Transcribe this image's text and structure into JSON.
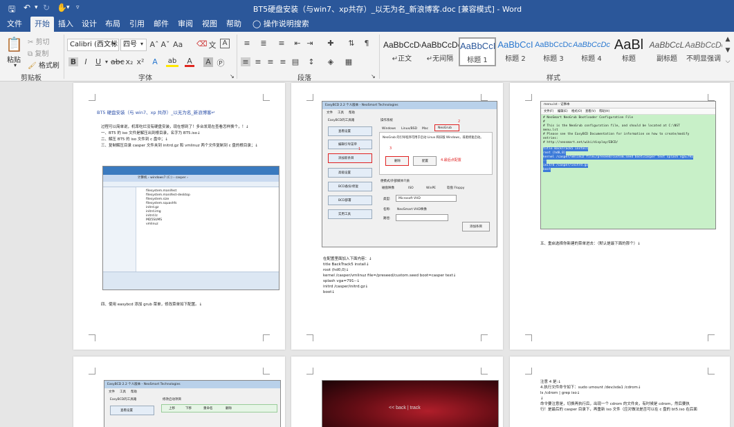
{
  "window": {
    "title": "BT5硬盘安装（与win7、xp共存）_以无为名_新浪博客.doc [兼容模式] - Word"
  },
  "quick_access": {
    "save_icon": "save-icon",
    "undo_icon": "undo-icon",
    "redo_icon": "redo-icon",
    "touch_icon": "touch-mode-icon",
    "customize_icon": "customize-icon"
  },
  "tabs": [
    "文件",
    "开始",
    "插入",
    "设计",
    "布局",
    "引用",
    "邮件",
    "审阅",
    "视图",
    "帮助"
  ],
  "tell_me": "操作说明搜索",
  "clipboard": {
    "paste": "粘贴",
    "cut": "剪切",
    "copy": "复制",
    "format_painter": "格式刷",
    "group_label": "剪贴板"
  },
  "font": {
    "name": "Calibri (西文标",
    "size": "四号",
    "group_label": "字体"
  },
  "paragraph": {
    "group_label": "段落"
  },
  "styles": {
    "group_label": "样式",
    "items": [
      {
        "preview": "AaBbCcDc",
        "name": "↵正文"
      },
      {
        "preview": "AaBbCcDc",
        "name": "↵无间隔"
      },
      {
        "preview": "AaBbCcI",
        "name": "标题 1"
      },
      {
        "preview": "AaBbCcI",
        "name": "标题 2"
      },
      {
        "preview": "AaBbCcDc",
        "name": "标题 3"
      },
      {
        "preview": "AaBbCcDc",
        "name": "标题 4"
      },
      {
        "preview": "AaBl",
        "name": "标题"
      },
      {
        "preview": "AaBbCcL",
        "name": "副标题"
      },
      {
        "preview": "AaBbCcDc",
        "name": "不明显强调"
      }
    ]
  },
  "pages": {
    "p1": {
      "heading": "BT5 硬盘安装（与 win7、xp 共存）_以无为名_新浪博客↵",
      "lines": [
        "过程可以简单说，机率吃烂没有硬盘安装，现在想到了！多台发现在查看怎样换个，！↓",
        "一、BT5 的 iso 文件是解压出到根目录，名字为 BT5.iso↓",
        "二、解压 BT5 的 iso 文件到 c 盘中；↓",
        "三、复制解压目录 casper 文件夹到 initrd.gz 和 vmlinuz 两个文件复制到 c 盘的根目录；↓"
      ],
      "explorer_path": "计算机 › windows7 (C:) › casper ›",
      "file_rows": [
        "filesystem.manifest",
        "filesystem.manifest-desktop",
        "filesystem.size",
        "filesystem.squashfs",
        "initrd.gz",
        "initrd.img",
        "initrd.lz",
        "MD5SUMS",
        "vmlinuz"
      ],
      "footer": "四、使用 easybcd 添加 grub 菜单，修改菜单如下配置。↓"
    },
    "p2": {
      "window_title": "EasyBCD 2.2 个人版本 - NeoSmart Technologies",
      "menu": [
        "文件",
        "工具",
        "帮助"
      ],
      "sidebar_title": "EasyBCD的工具箱",
      "sidebar": [
        "查看设置",
        "编辑引导菜单",
        "添加新条目",
        "高级设置",
        "BCD备份/修复",
        "BCD部署",
        "实用工具"
      ],
      "right_title": "操作系统",
      "os_tabs": [
        "Windows",
        "Linux/BSD",
        "Mac",
        "NeoGrub"
      ],
      "neogrub_text": "NeoGrub 的引导程序可用于启动 Linux 和旧版 Windows，或者修复启动。",
      "install_btn": "删除",
      "config_btn": "配置",
      "annot_config": "4.最后点配置",
      "portable_title": "便携式/外部媒体介质",
      "portable_tabs": [
        "磁盘映像",
        "ISO",
        "WinPE",
        "软盘 Floppy"
      ],
      "type_label": "类型:",
      "type_value": "Microsoft VHD",
      "name_label": "名称:",
      "name_value": "NeoSmart VHD映像",
      "path_label": "路径:",
      "add_btn": "添加条目",
      "marker1": "1",
      "marker2": "2",
      "marker3": "3",
      "lines": [
        "在配置里面加入下面内容：↓",
        "title BackTrack5 install↓",
        "root (hd0,0)↓",
        "kernel /casper/vmlinuz file=/preseed/custom.seed boot=casper text↓",
        "splash vga=791--↓",
        "initrd /casper/initrd.gz↓",
        "boot↓"
      ]
    },
    "p3": {
      "window_title": "menu.lst - 记事本",
      "menu": [
        "文件(F)",
        "编辑(E)",
        "格式(O)",
        "查看(V)",
        "帮助(H)"
      ],
      "code": [
        "# NeoSmart NeoGrub Bootloader Configuration File",
        "#",
        "# This is the NeoGrub configuration file, and should be located at C:\\NST",
        "menu.lst",
        "# Please see the EasyBCD Documentation for information on how to create/modify",
        "entries:",
        "# http://neosmart.net/wiki/display/EBCD/"
      ],
      "code_sel": [
        "title BackTrack5 install",
        "root (hd0,0)",
        "kernel /casper/vmlinuz file=/preseed/custom.seed boot=casper text splash vga=791",
        "--",
        "initrd /casper/initrd.gz",
        "boot"
      ],
      "note": "五、重启选择你新建的菜单进去：（默认是最下面的那个）↓"
    },
    "p4": {
      "window_title": "EasyBCD 2.2 个人版本 - NeoSmart Technologies",
      "menu": [
        "文件",
        "工具",
        "帮助"
      ],
      "sidebar_title": "EasyBCD的工具箱",
      "right_title": "修改启动项目",
      "sidebar_item": "查看设置",
      "toolbar": [
        "上移",
        "下移",
        "重命名",
        "删除"
      ]
    },
    "p5": {
      "banner": "<< back | track"
    },
    "p6": {
      "lines": [
        "注意 4 是:↓",
        "4.执行文件命令如下：sudo umount /dev/sda1 /cdrom↓",
        "ls /cdrom | grep iso↓",
        "↓",
        "命令要注意是，切换再执行后，出现一个 cdrom 的文件夹，有时候是 cdrom，然后要执",
        "行！是最后的 casper 目录下，再重新 iso 文件（应对做法是否可以在 c 盘的 bt5.iso 在后面"
      ]
    }
  }
}
